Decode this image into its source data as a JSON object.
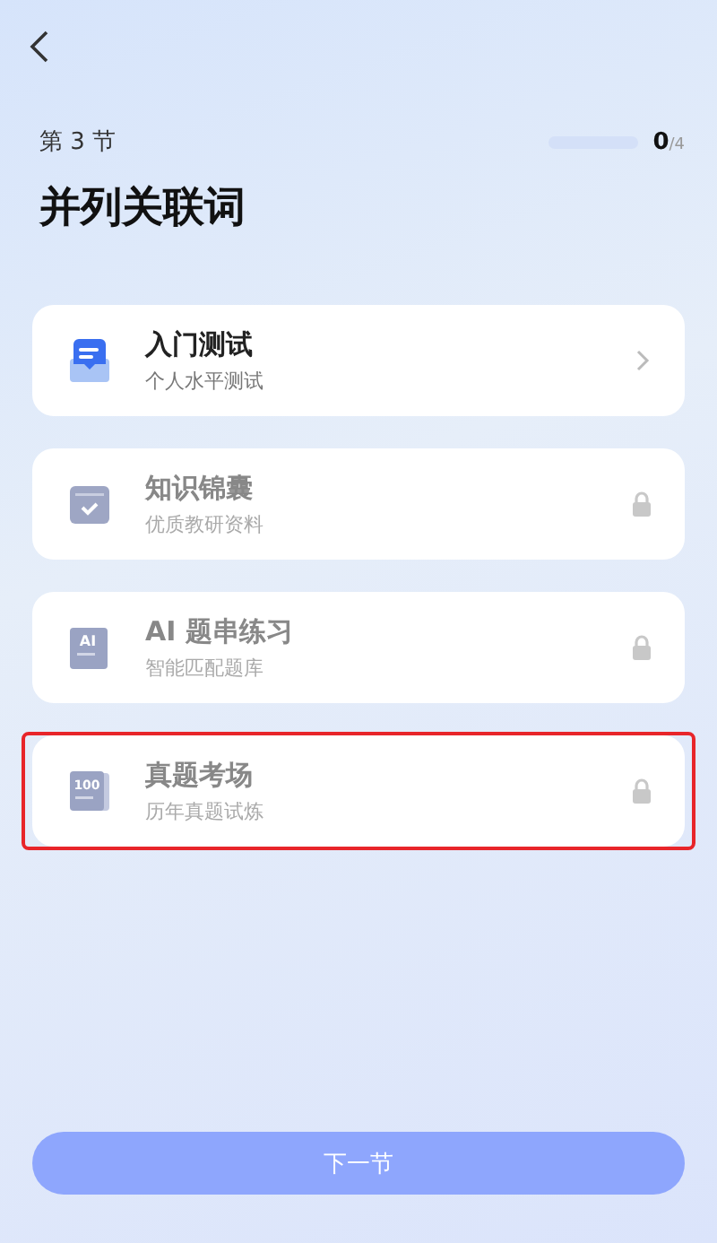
{
  "section": {
    "label": "第 3 节",
    "title": "并列关联词"
  },
  "progress": {
    "level": 0,
    "done": "0",
    "total": "/4"
  },
  "items": [
    {
      "kind": "test",
      "title": "入门测试",
      "subtitle": "个人水平测试",
      "locked": false,
      "highlighted": false
    },
    {
      "kind": "book",
      "title": "知识锦囊",
      "subtitle": "优质教研资料",
      "locked": true,
      "highlighted": false
    },
    {
      "kind": "ai",
      "badge": "AI",
      "title": "AI 题串练习",
      "subtitle": "智能匹配题库",
      "locked": true,
      "highlighted": false
    },
    {
      "kind": "exam",
      "badge": "100",
      "title": "真题考场",
      "subtitle": "历年真题试炼",
      "locked": true,
      "highlighted": true
    }
  ],
  "next_button": {
    "label": "下一节",
    "disabled": true
  }
}
